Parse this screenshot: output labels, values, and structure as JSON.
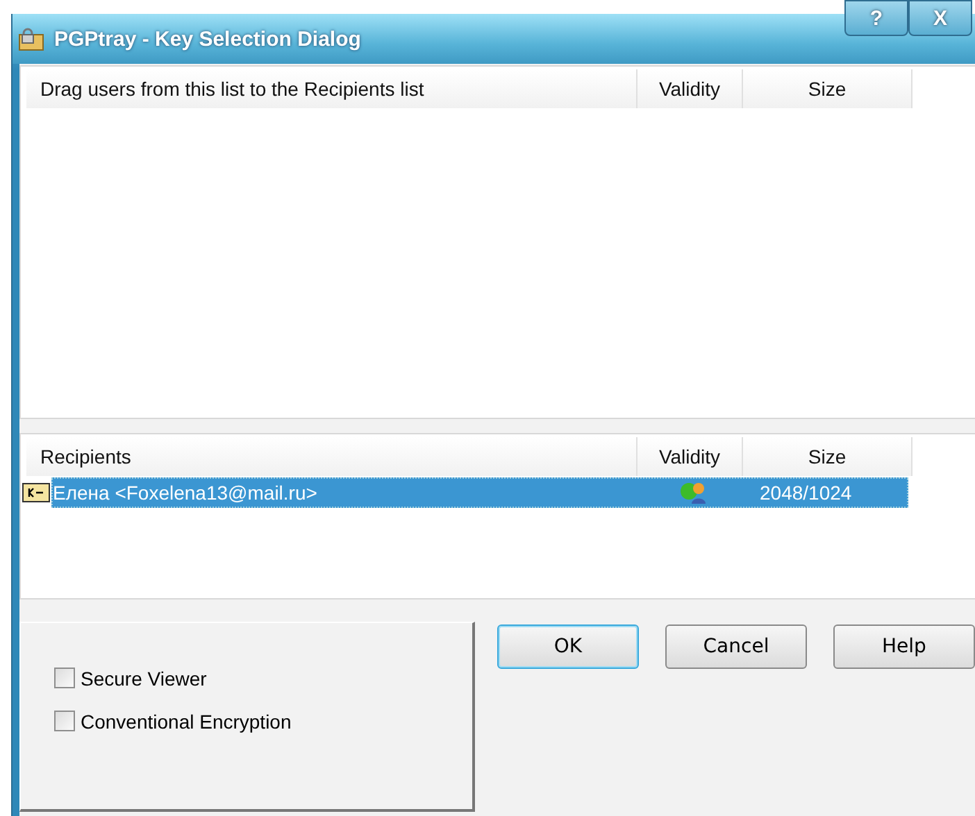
{
  "window": {
    "title": "PGPtray - Key Selection Dialog",
    "controls": [
      "?",
      "X"
    ]
  },
  "keys_list": {
    "columns": [
      "Drag users from this list to the Recipients list",
      "Validity",
      "Size"
    ]
  },
  "recipients_list": {
    "columns": [
      "Recipients",
      "Validity",
      "Size"
    ],
    "rows": [
      {
        "name": "Елена <Foxelena13@mail.ru>",
        "size": "2048/1024",
        "selected": true
      }
    ]
  },
  "options": [
    {
      "label": "Secure Viewer",
      "checked": false
    },
    {
      "label": "Conventional Encryption",
      "checked": false
    }
  ],
  "buttons": [
    {
      "label": "OK",
      "default": true
    },
    {
      "label": "Cancel",
      "default": false
    },
    {
      "label": "Help",
      "default": false
    }
  ]
}
